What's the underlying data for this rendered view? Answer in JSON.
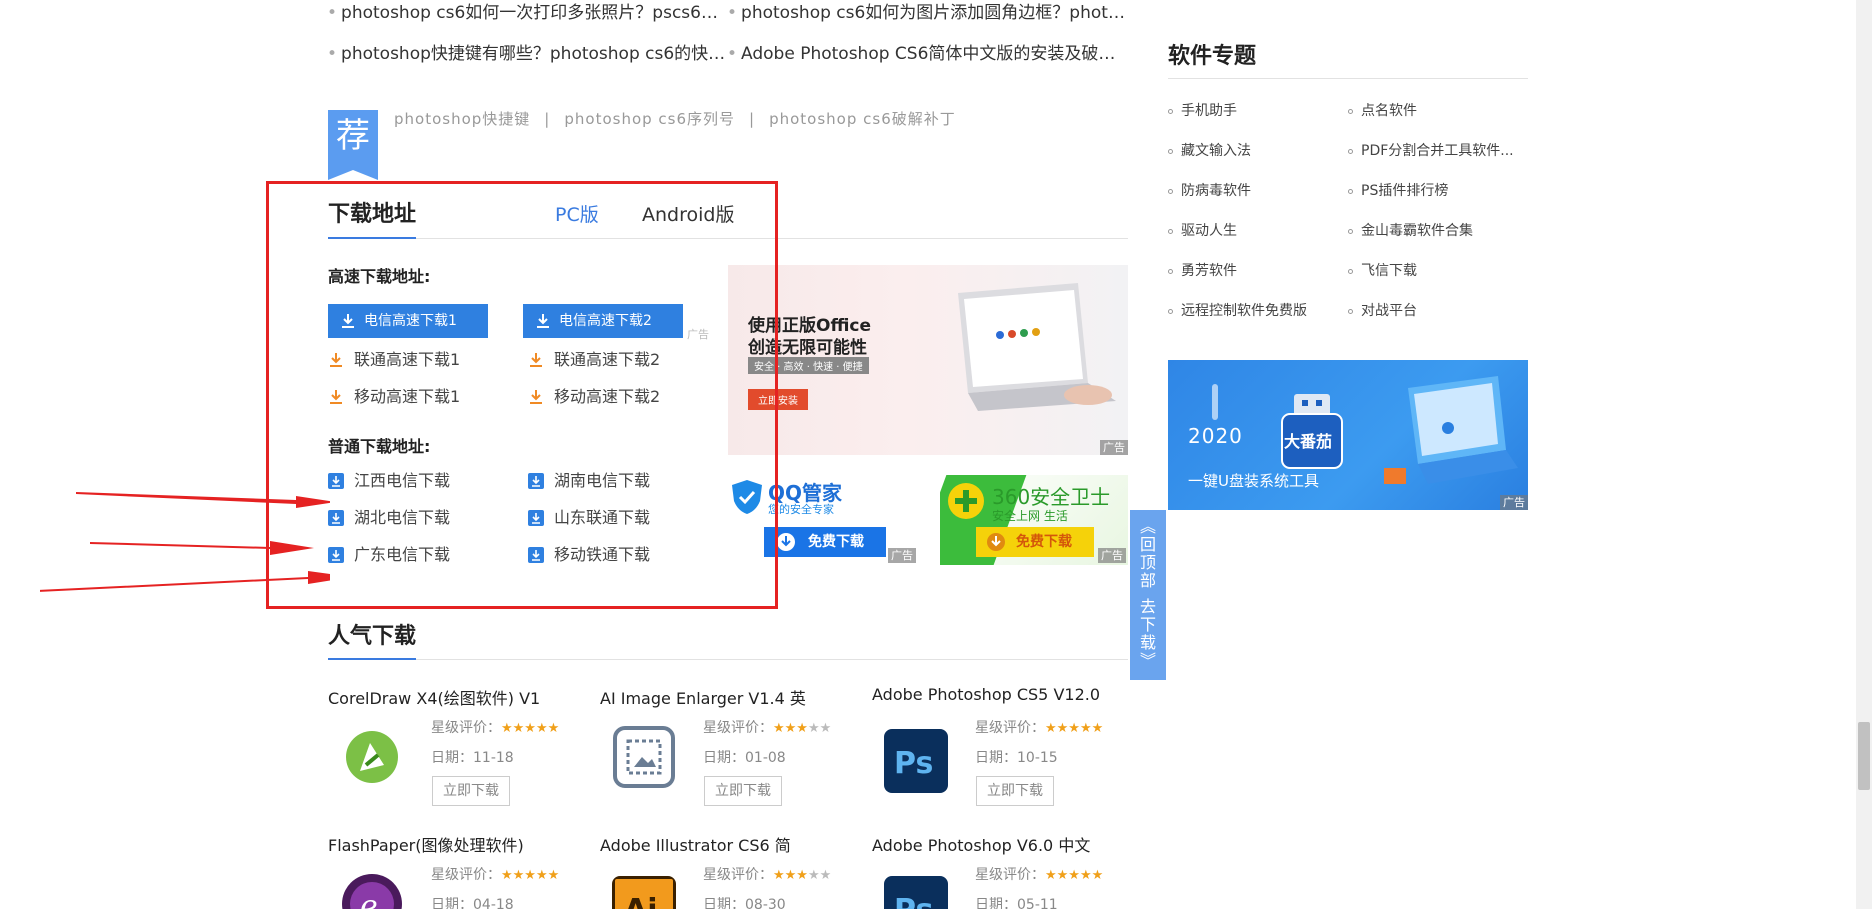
{
  "related_links": [
    "photoshop cs6如何一次打印多张照片？pscs6一...",
    "photoshop cs6如何为图片添加圆角边框？photo...",
    "photoshop快捷键有哪些？photoshop cs6的快捷...",
    "Adobe Photoshop CS6简体中文版的安装及破解..."
  ],
  "recommend": {
    "badge": "荐",
    "tags": [
      "photoshop快捷键",
      "photoshop cs6序列号",
      "photoshop cs6破解补丁"
    ],
    "sep": "|"
  },
  "download": {
    "title": "下载地址",
    "tabs": [
      "PC版",
      "Android版"
    ],
    "fast_heading": "高速下载地址:",
    "fast_buttons": [
      "电信高速下载1",
      "电信高速下载2"
    ],
    "fast_links": [
      "联通高速下载1",
      "联通高速下载2",
      "移动高速下载1",
      "移动高速下载2"
    ],
    "normal_heading": "普通下载地址:",
    "normal_links": [
      "江西电信下载",
      "湖南电信下载",
      "湖北电信下载",
      "山东联通下载",
      "广东电信下载",
      "移动铁通下载"
    ],
    "small_ad_label": "广告"
  },
  "ads": {
    "office": {
      "line1": "使用正版Office",
      "line2": "创造无限可能性",
      "tagline": "安全 · 高效 · 快速 · 便捷",
      "button": "立即安装",
      "label": "广告"
    },
    "qq": {
      "name": "QQ管家",
      "slogan": "您的安全专家",
      "button": "免费下载",
      "label": "广告"
    },
    "s360": {
      "name": "360安全卫士",
      "slogan": "安全上网 生活",
      "button": "免费下载",
      "label": "广告"
    },
    "tomato": {
      "year": "2020",
      "brand": "大番茄",
      "slogan": "一键U盘装系统工具",
      "label": "广告"
    }
  },
  "popular": {
    "title": "人气下载",
    "rating_label": "星级评价：",
    "date_label": "日期：",
    "button": "立即下载",
    "items": [
      {
        "name": "CorelDraw X4(绘图软件) V1",
        "rating": 5,
        "date": "11-18",
        "icon": "coreldraw-icon"
      },
      {
        "name": "AI Image Enlarger V1.4 英",
        "rating": 3,
        "date": "01-08",
        "icon": "image-enlarger-icon"
      },
      {
        "name": "Adobe Photoshop CS5 V12.0",
        "rating": 5,
        "date": "10-15",
        "icon": "photoshop-icon"
      },
      {
        "name": "FlashPaper(图像处理软件)",
        "rating": 5,
        "date": "04-18",
        "icon": "flashpaper-icon"
      },
      {
        "name": "Adobe Illustrator CS6 简",
        "rating": 3,
        "date": "08-30",
        "icon": "illustrator-icon"
      },
      {
        "name": "Adobe Photoshop V6.0 中文",
        "rating": 5,
        "date": "05-11",
        "icon": "photoshop-icon"
      }
    ]
  },
  "sidebar": {
    "title": "软件专题",
    "links": [
      "手机助手",
      "点名软件",
      "藏文输入法",
      "PDF分割合并工具软件...",
      "防病毒软件",
      "PS插件排行榜",
      "驱动人生",
      "金山毒霸软件合集",
      "勇芳软件",
      "飞信下载",
      "远程控制软件免费版",
      "对战平台"
    ]
  },
  "float_tab": {
    "top": "回顶部",
    "down": "去下载"
  },
  "colors": {
    "accent": "#3a7be0",
    "annotation_red": "#e52222",
    "download_orange": "#f08a24"
  }
}
